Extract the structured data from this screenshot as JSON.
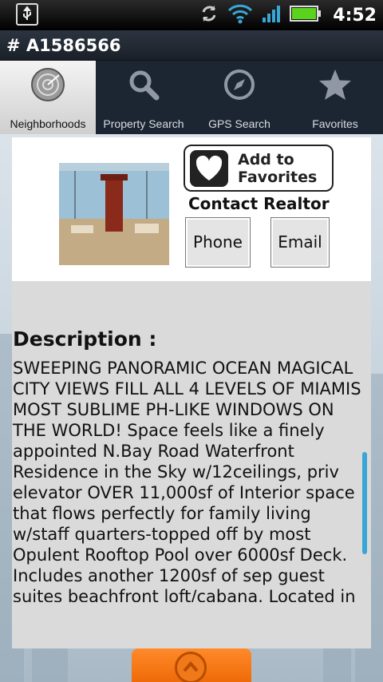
{
  "status_bar": {
    "time": "4:52"
  },
  "title": "# A1586566",
  "tabs": [
    {
      "label": "Neighborhoods",
      "icon": "radar-icon",
      "active": true
    },
    {
      "label": "Property Search",
      "icon": "search-icon",
      "active": false
    },
    {
      "label": "GPS Search",
      "icon": "compass-icon",
      "active": false
    },
    {
      "label": "Favorites",
      "icon": "star-icon",
      "active": false
    }
  ],
  "listing": {
    "add_favorites_line1": "Add to",
    "add_favorites_line2": "Favorites",
    "contact_heading": "Contact Realtor",
    "phone_label": "Phone",
    "email_label": "Email",
    "description_heading": "Description :",
    "description": "SWEEPING PANORAMIC OCEAN  MAGICAL CITY VIEWS FILL ALL 4 LEVELS OF MIAMIS MOST SUBLIME PH-LIKE WINDOWS ON THE WORLD! Space feels like a finely appointed N.Bay Road Waterfront Residence in the Sky w/12ceilings, priv elevator  OVER 11,000sf of Interior space that flows perfectly for family living w/staff quarters-topped off by most Opulent Rooftop Pool  over 6000sf Deck. Includes another 1200sf of sep guest suites beachfront loft/cabana. Located in the"
  },
  "colors": {
    "accent_scroll": "#39a6d6",
    "handle": "#f07a1a"
  }
}
